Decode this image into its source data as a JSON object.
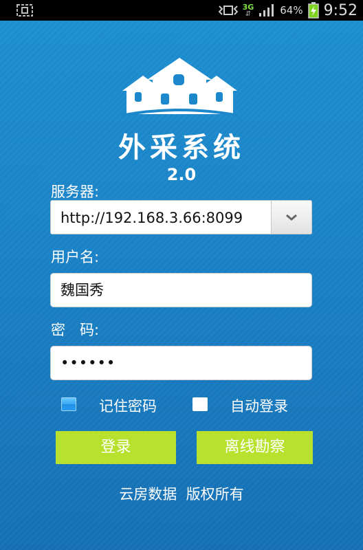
{
  "status_bar": {
    "battery_percent": "64%",
    "network": "3G",
    "time": "9:52"
  },
  "app": {
    "title": "外采系统",
    "version": "2.0"
  },
  "form": {
    "server": {
      "label": "服务器:",
      "value": "http://192.168.3.66:8099"
    },
    "username": {
      "label": "用户名:",
      "value": "魏国秀"
    },
    "password": {
      "label": "密　码:",
      "value": "••••••"
    },
    "remember_password": {
      "label": "记住密码",
      "checked": true
    },
    "auto_login": {
      "label": "自动登录",
      "checked": false
    }
  },
  "buttons": {
    "login": "登录",
    "offline_survey": "离线勘察"
  },
  "footer": {
    "copyright": "云房数据  版权所有"
  },
  "colors": {
    "background": "#1a82c6",
    "button": "#b7e12c"
  },
  "icons": [
    "screenshot-icon",
    "vibrate-icon",
    "signal-3g-icon",
    "signal-bars-icon",
    "battery-charging-icon",
    "house-logo-icon",
    "chevron-down-icon"
  ]
}
